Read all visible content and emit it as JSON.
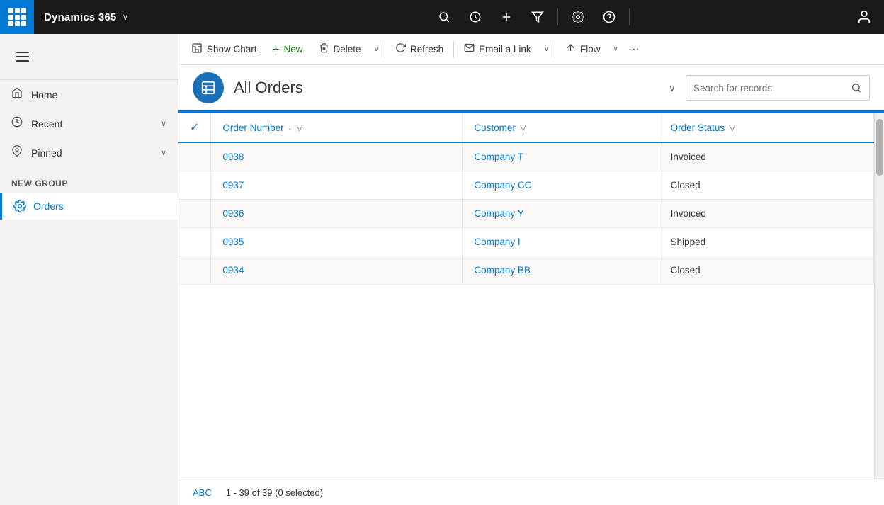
{
  "topNav": {
    "appName": "Dynamics 365",
    "appChevron": "∨",
    "icons": {
      "search": "🔍",
      "recent": "⟳",
      "add": "+",
      "filter": "⊻",
      "settings": "⚙",
      "help": "?",
      "user": "👤"
    }
  },
  "sidebar": {
    "hamburgerLabel": "Menu",
    "navItems": [
      {
        "id": "home",
        "label": "Home",
        "icon": "⌂"
      },
      {
        "id": "recent",
        "label": "Recent",
        "icon": "⏱",
        "hasChevron": true
      },
      {
        "id": "pinned",
        "label": "Pinned",
        "icon": "📌",
        "hasChevron": true
      }
    ],
    "groupLabel": "New Group",
    "groupItems": [
      {
        "id": "orders",
        "label": "Orders",
        "icon": "⚙"
      }
    ]
  },
  "commandBar": {
    "buttons": [
      {
        "id": "show-chart",
        "label": "Show Chart",
        "icon": "📊"
      },
      {
        "id": "new",
        "label": "New",
        "icon": "+",
        "isGreen": true
      },
      {
        "id": "delete",
        "label": "Delete",
        "icon": "🗑"
      },
      {
        "id": "refresh",
        "label": "Refresh",
        "icon": "↺"
      },
      {
        "id": "email-link",
        "label": "Email a Link",
        "icon": "✉"
      },
      {
        "id": "flow",
        "label": "Flow",
        "icon": "↗"
      }
    ],
    "moreLabel": "···"
  },
  "pageHeader": {
    "title": "All Orders",
    "titleChevron": "∨",
    "searchPlaceholder": "Search for records"
  },
  "table": {
    "columns": [
      {
        "id": "check",
        "label": "✓"
      },
      {
        "id": "order-number",
        "label": "Order Number",
        "sortable": true,
        "filterable": true
      },
      {
        "id": "customer",
        "label": "Customer",
        "filterable": true
      },
      {
        "id": "order-status",
        "label": "Order Status",
        "filterable": true
      }
    ],
    "rows": [
      {
        "orderNumber": "0938",
        "customer": "Company T",
        "orderStatus": "Invoiced"
      },
      {
        "orderNumber": "0937",
        "customer": "Company CC",
        "orderStatus": "Closed"
      },
      {
        "orderNumber": "0936",
        "customer": "Company Y",
        "orderStatus": "Invoiced"
      },
      {
        "orderNumber": "0935",
        "customer": "Company I",
        "orderStatus": "Shipped"
      },
      {
        "orderNumber": "0934",
        "customer": "Company BB",
        "orderStatus": "Closed"
      }
    ]
  },
  "footer": {
    "abcLabel": "ABC",
    "countLabel": "1 - 39 of 39 (0 selected)"
  }
}
